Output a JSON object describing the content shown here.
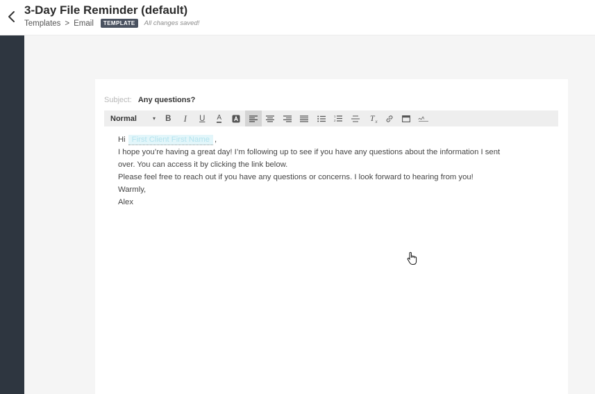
{
  "header": {
    "title": "3-Day File Reminder (default)",
    "breadcrumb": {
      "templates": "Templates",
      "separator": ">",
      "email": "Email"
    },
    "badge": "TEMPLATE",
    "save_status": "All changes saved!"
  },
  "email": {
    "subject_label": "Subject:",
    "subject": "Any questions?",
    "body": {
      "greeting": "Hi",
      "merge_tag": "First Client First Name",
      "greeting_suffix": ",",
      "line1": "I hope you’re having a great day! I’m following up to see if you have any questions about the information I sent",
      "line2": "over. You can access it by clicking the link below.",
      "line3": "Please feel free to reach out if you have any questions or concerns. I look forward to hearing from you!",
      "line4": "Warmly,",
      "line5": "Alex"
    }
  },
  "toolbar": {
    "style_select": "Normal",
    "bold": "B",
    "italic": "I",
    "underline": "U",
    "font_color": "A",
    "clear_format": "T",
    "active_button": "align-left",
    "buttons": [
      "bold",
      "italic",
      "underline",
      "font-color",
      "highlight",
      "align-left",
      "align-center",
      "align-right",
      "justify",
      "bullet-list",
      "numbered-list",
      "strikethrough",
      "clear-formatting",
      "link",
      "embed",
      "signature"
    ]
  },
  "colors": {
    "rail": "#2e3640",
    "badge": "#4a5260",
    "merge_tag_bg": "#e3f6fa",
    "toolbar_bg": "#eeeeee"
  }
}
